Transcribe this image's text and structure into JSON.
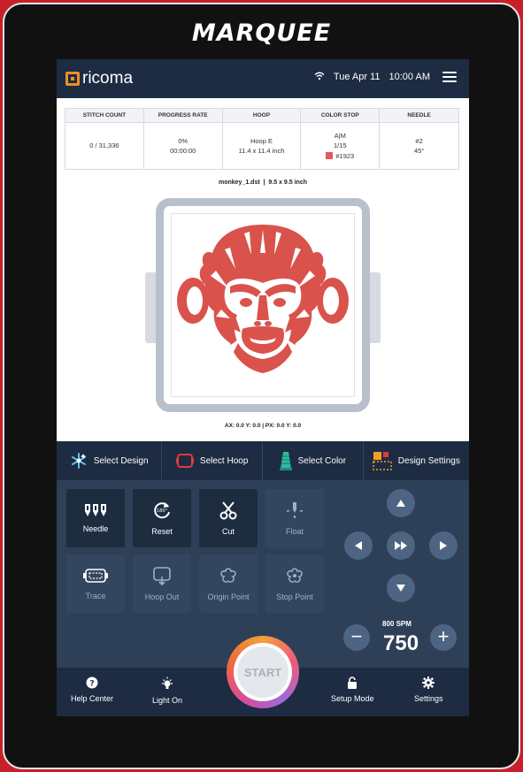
{
  "brand": "MARQUEE",
  "app": {
    "logo": "ricoma",
    "date": "Tue Apr 11",
    "time": "10:00 AM"
  },
  "stats": {
    "stitch_count": {
      "label": "STITCH COUNT",
      "value": "0 / 31,336"
    },
    "progress_rate": {
      "label": "PROGRESS RATE",
      "percent": "0%",
      "elapsed": "00:00:00"
    },
    "hoop": {
      "label": "HOOP",
      "name": "Hoop E",
      "size": "11.4 x 11.4 inch"
    },
    "color_stop": {
      "label": "COLOR STOP",
      "mode": "A|M",
      "count": "1/15",
      "color_code": "#1923",
      "swatch_color": "#e55a5a"
    },
    "needle": {
      "label": "NEEDLE",
      "number": "#2",
      "angle": "45°"
    }
  },
  "design": {
    "file": "monkey_1.dst",
    "size": "9.5 x 9.5 inch",
    "coords": "AX: 0.0  Y: 0.0   |   PX: 0.0  Y: 0.0",
    "thread_color": "#d9534c"
  },
  "actions": {
    "select_design": "Select Design",
    "select_hoop": "Select Hoop",
    "select_color": "Select Color",
    "design_settings": "Design Settings"
  },
  "controls": {
    "needle": "Needle",
    "reset": "Reset",
    "cut": "Cut",
    "float": "Float",
    "trace": "Trace",
    "hoop_out": "Hoop Out",
    "origin_point": "Origin Point",
    "stop_point": "Stop Point"
  },
  "speed": {
    "label": "800 SPM",
    "value": "750"
  },
  "start_label": "START",
  "nav": {
    "help_center": "Help Center",
    "light_on": "Light On",
    "setup_mode": "Setup Mode",
    "settings": "Settings"
  },
  "colors": {
    "navy": "#1d2c42",
    "panel": "#2e4058",
    "accent_orange": "#e8902a",
    "brand_red": "#c8202a"
  }
}
